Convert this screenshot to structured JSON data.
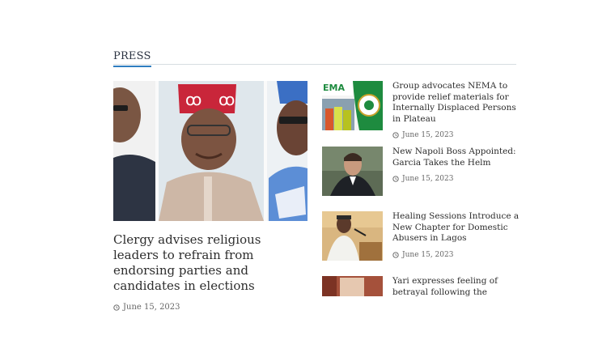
{
  "section": {
    "title": "PRESS"
  },
  "featured": {
    "title": "Clergy advises religious leaders to refrain from endorsing parties and candidates in elections",
    "date": "June 15, 2023"
  },
  "news": [
    {
      "title": "Group advocates NEMA to provide relief materials for Internally Displaced Persons in Plateau",
      "date": "June 15, 2023",
      "thumb_text": "EMA"
    },
    {
      "title": "New Napoli Boss Appointed: Garcia Takes the Helm",
      "date": "June 15, 2023"
    },
    {
      "title": "Healing Sessions Introduce a New Chapter for Domestic Abusers in Lagos",
      "date": "June 15, 2023"
    },
    {
      "title": "Yari expresses feeling of betrayal following the election outcome",
      "date": ""
    }
  ],
  "icons": {
    "date": "clock-icon"
  },
  "colors": {
    "accent": "#2f7dc0",
    "text": "#2d2d2d",
    "meta": "#666666"
  }
}
